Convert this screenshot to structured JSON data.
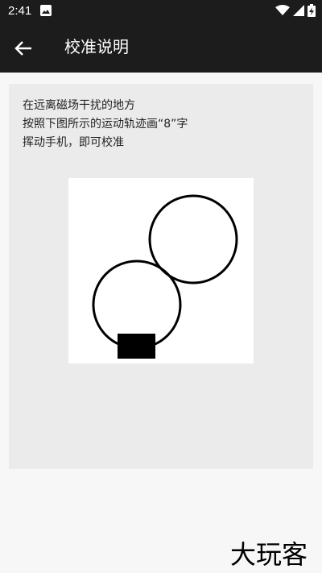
{
  "status_bar": {
    "time": "2:41",
    "icons": [
      "photo-icon",
      "wifi-icon",
      "signal-icon",
      "battery-charging-icon"
    ]
  },
  "app_bar": {
    "back_icon": "arrow-back-icon",
    "title": "校准说明"
  },
  "card": {
    "instructions": [
      "在远离磁场干扰的地方",
      "按照下图所示的运动轨迹画“8”字",
      "挥动手机，即可校准"
    ]
  },
  "diagram": {
    "description_icon": "figure-eight-phone-motion"
  },
  "watermark": {
    "text": "大玩客"
  },
  "colors": {
    "app_bar": "#1c1c1c",
    "card_bg": "#ebebeb",
    "page_bg": "#f7f7f7",
    "text": "#222222"
  }
}
